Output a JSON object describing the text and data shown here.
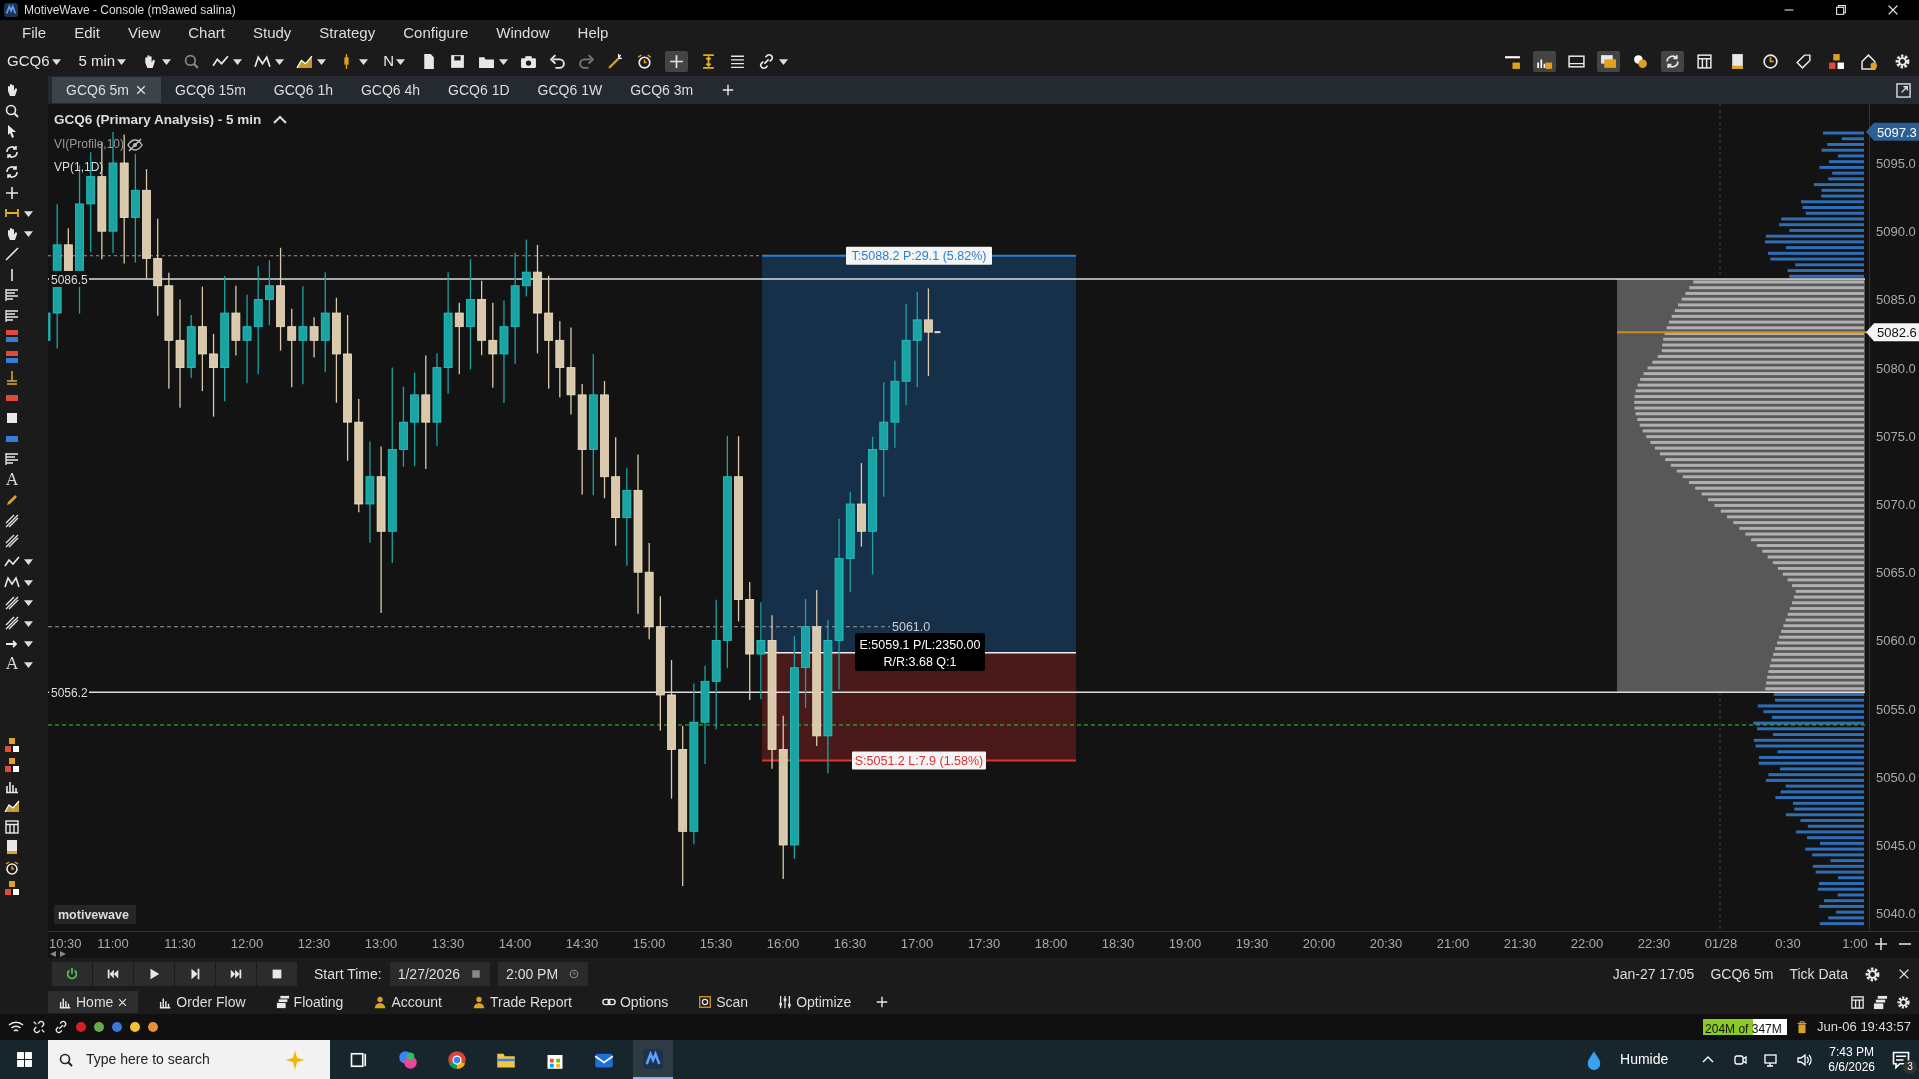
{
  "window": {
    "title": "MotiveWave - Console (m9awed salina)"
  },
  "menu": [
    "File",
    "Edit",
    "View",
    "Chart",
    "Study",
    "Strategy",
    "Configure",
    "Window",
    "Help"
  ],
  "toolbar": {
    "symbol": "GCQ6",
    "interval": "5 min",
    "bar_type": "N"
  },
  "tool_glyphs": [
    "A",
    "A"
  ],
  "chart_tabs": [
    {
      "label": "GCQ6 5m",
      "selected": true
    },
    {
      "label": "GCQ6 15m",
      "selected": false
    },
    {
      "label": "GCQ6 1h",
      "selected": false
    },
    {
      "label": "GCQ6 4h",
      "selected": false
    },
    {
      "label": "GCQ6 1D",
      "selected": false
    },
    {
      "label": "GCQ6 1W",
      "selected": false
    },
    {
      "label": "GCQ6 3m",
      "selected": false
    }
  ],
  "chart": {
    "title": "GCQ6 (Primary Analysis) - 5 min",
    "studies": [
      "VI(Profile,10)",
      "VP(1,1D)"
    ],
    "brand": "motivewave",
    "price_labels": [
      "5095.0",
      "5090.0",
      "5085.0",
      "5080.0",
      "5075.0",
      "5070.0",
      "5065.0",
      "5060.0",
      "5055.0",
      "5050.0",
      "5045.0",
      "5040.0"
    ],
    "time_labels": [
      "10:30",
      "11:00",
      "11:30",
      "12:00",
      "12:30",
      "13:00",
      "13:30",
      "14:00",
      "14:30",
      "15:00",
      "15:30",
      "16:00",
      "16:30",
      "17:00",
      "17:30",
      "18:00",
      "18:30",
      "19:00",
      "19:30",
      "20:00",
      "20:30",
      "21:00",
      "21:30",
      "22:00",
      "22:30",
      "01/28",
      "0:30",
      "1:00"
    ],
    "high_tag": "5097.3",
    "last_tag": "5082.6",
    "levels": [
      "5086.5",
      "5056.2"
    ],
    "position": {
      "target": "T:5088.2 P:29.1 (5.82%)",
      "entry_level": "5061.0",
      "entry": "E:5059.1 P/L:2350.00",
      "ratio": "R/R:3.68 Q:1",
      "stop": "S:5051.2 L:7.9 (1.58%)"
    }
  },
  "playback": {
    "start_label": "Start Time:",
    "date": "1/27/2026",
    "time": "2:00 PM",
    "info": [
      "Jan-27 17:05",
      "GCQ6 5m",
      "Tick Data"
    ]
  },
  "bottom_tabs": [
    {
      "label": "Home",
      "selected": true
    },
    {
      "label": "Order Flow",
      "selected": false
    },
    {
      "label": "Floating",
      "selected": false
    },
    {
      "label": "Account",
      "selected": false
    },
    {
      "label": "Trade Report",
      "selected": false
    },
    {
      "label": "Options",
      "selected": false
    },
    {
      "label": "Scan",
      "selected": false
    },
    {
      "label": "Optimize",
      "selected": false
    }
  ],
  "status": {
    "dots": [
      {
        "color": "#d42020"
      },
      {
        "color": "#6aa84f"
      },
      {
        "color": "#3c78d8"
      },
      {
        "color": "#f1c232"
      },
      {
        "color": "#e69138"
      }
    ],
    "memory": {
      "text": "204M of 347M",
      "level": 0.59
    },
    "datetime": "Jun-06 19:43:57"
  },
  "taskbar": {
    "search_placeholder": "Type here to search",
    "weather": "Humide",
    "time": "7:43 PM",
    "date": "6/6/2026",
    "notifications": "3"
  }
}
